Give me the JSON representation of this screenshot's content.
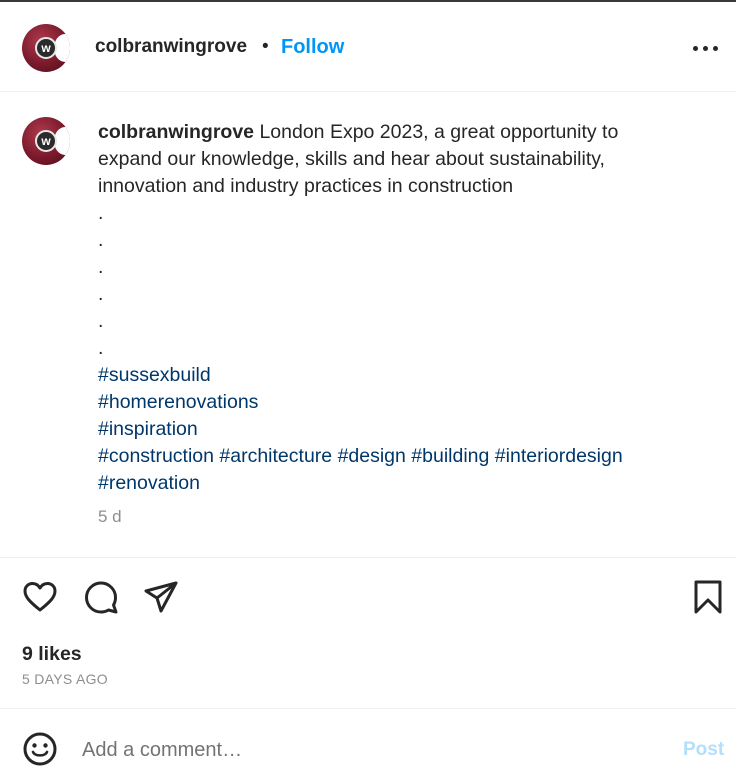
{
  "post": {
    "username": "colbranwingrove",
    "separator": "•",
    "follow_label": "Follow",
    "avatar_letter": "w"
  },
  "caption": {
    "username": "colbranwingrove",
    "text": "London Expo 2023, a great opportunity to",
    "line2": "expand our knowledge, skills and hear about sustainability,",
    "line3": "innovation and industry practices in construction",
    "dots": [
      ".",
      ".",
      ".",
      ".",
      ".",
      "."
    ],
    "hashtags_line1": "#sussexbuild",
    "hashtags_line2": "#homerenovations",
    "hashtags_line3": "#inspiration",
    "hashtags_line4": [
      "#construction",
      "#architecture",
      "#design",
      "#building",
      "#interiordesign"
    ],
    "hashtags_line5": "#renovation",
    "timestamp": "5 d"
  },
  "engagement": {
    "likes": "9 likes",
    "date": "5 DAYS AGO"
  },
  "comment": {
    "placeholder": "Add a comment…",
    "post_label": "Post"
  },
  "colors": {
    "accent": "#0095f6",
    "hashtag": "#00376b",
    "muted": "#8e8e8e",
    "post_disabled": "#b2dffc"
  },
  "icons": [
    "more-icon",
    "heart-icon",
    "comment-icon",
    "share-icon",
    "bookmark-icon",
    "emoji-icon"
  ]
}
